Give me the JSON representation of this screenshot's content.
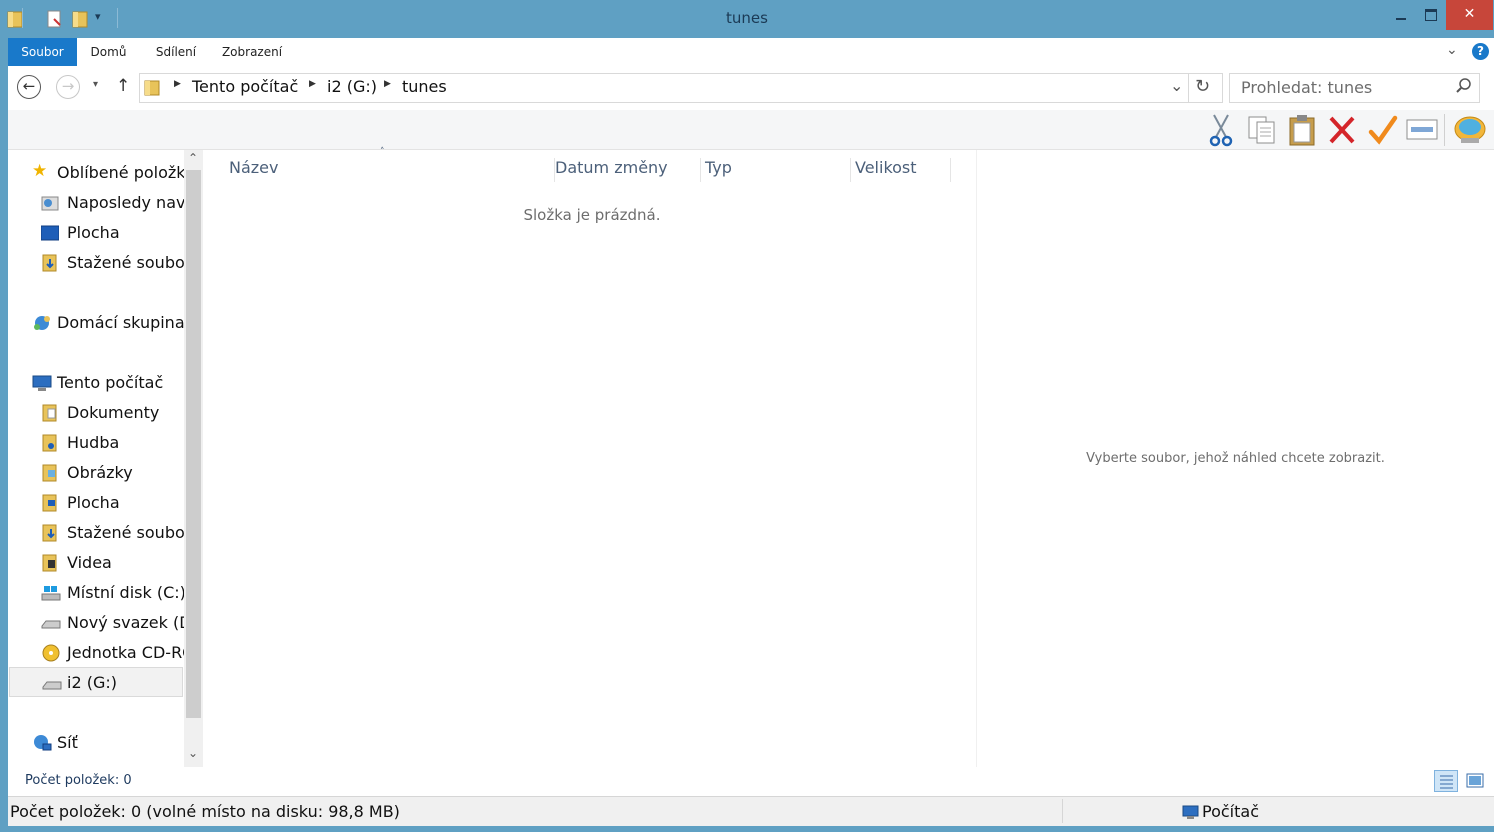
{
  "window": {
    "title": "tunes",
    "controls": {
      "minimize": "—",
      "maximize": "□",
      "close": "✕"
    }
  },
  "ribbon": {
    "tabs": [
      {
        "label": "Soubor",
        "active": true
      },
      {
        "label": "Domů"
      },
      {
        "label": "Sdílení"
      },
      {
        "label": "Zobrazení"
      }
    ]
  },
  "address": {
    "back": "←",
    "forward": "→",
    "up": "↑",
    "breadcrumb": [
      "Tento počítač",
      "i2 (G:)",
      "tunes"
    ],
    "search_placeholder": "Prohledat: tunes"
  },
  "toolbar": {
    "icons": [
      "scissors-icon",
      "copy-icon",
      "paste-icon",
      "delete-icon",
      "check-icon",
      "rename-icon",
      "shell-icon"
    ]
  },
  "nav": {
    "favorites": {
      "label": "Oblíbené položky",
      "items": [
        "Naposledy navštívené",
        "Plocha",
        "Stažené soubory"
      ]
    },
    "homegroup": {
      "label": "Domácí skupina"
    },
    "thispc": {
      "label": "Tento počítač",
      "items": [
        "Dokumenty",
        "Hudba",
        "Obrázky",
        "Plocha",
        "Stažené soubory",
        "Videa",
        "Místní disk (C:)",
        "Nový svazek (D:)",
        "Jednotka CD-ROM",
        "i2 (G:)"
      ]
    },
    "network": {
      "label": "Síť"
    }
  },
  "content": {
    "columns": [
      "Název",
      "Datum změny",
      "Typ",
      "Velikost"
    ],
    "empty_message": "Složka je prázdná."
  },
  "preview": {
    "message": "Vyberte soubor, jehož náhled chcete zobrazit."
  },
  "status": {
    "item_count": "Počet položek: 0",
    "detail": "Počet položek: 0 (volné místo na disku: 98,8 MB)",
    "location": "Počítač"
  }
}
